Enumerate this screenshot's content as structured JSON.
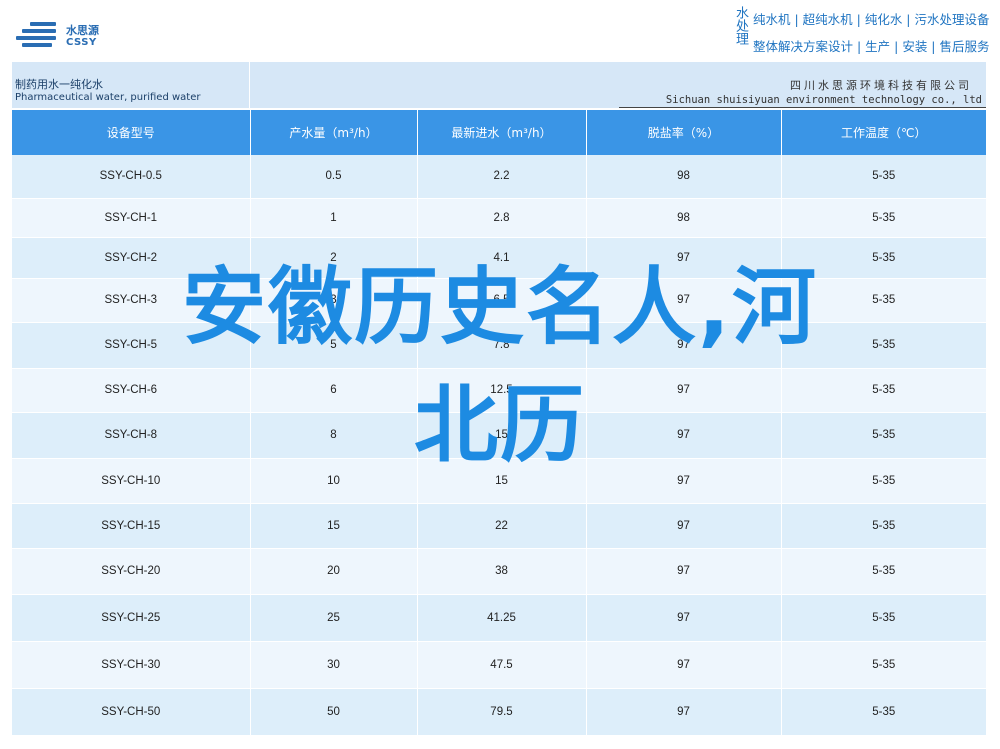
{
  "header": {
    "logo_cn": "水思源",
    "logo_en": "CSSY",
    "vertical_tag": "水处理",
    "line1": "纯水机 | 超纯水机 | 纯化水 | 污水处理设备",
    "line2": "整体解决方案设计 | 生产 | 安装 | 售后服务"
  },
  "band": {
    "left_cn": "制药用水一纯化水",
    "left_en": "Pharmaceutical water, purified water",
    "right_cn": "四川水思源环境科技有限公司",
    "right_en": "Sichuan shuisiyuan environment technology co., ltd"
  },
  "table": {
    "columns": [
      "设备型号",
      "产水量（m³/h）",
      "最新进水（m³/h）",
      "脱盐率（%）",
      "工作温度（℃）"
    ],
    "rows": [
      [
        "SSY-CH-0.5",
        "0.5",
        "2.2",
        "98",
        "5-35"
      ],
      [
        "SSY-CH-1",
        "1",
        "2.8",
        "98",
        "5-35"
      ],
      [
        "SSY-CH-2",
        "2",
        "4.1",
        "97",
        "5-35"
      ],
      [
        "SSY-CH-3",
        "3",
        "6.5",
        "97",
        "5-35"
      ],
      [
        "SSY-CH-5",
        "5",
        "7.8",
        "97",
        "5-35"
      ],
      [
        "SSY-CH-6",
        "6",
        "12.5",
        "97",
        "5-35"
      ],
      [
        "SSY-CH-8",
        "8",
        "15",
        "97",
        "5-35"
      ],
      [
        "SSY-CH-10",
        "10",
        "15",
        "97",
        "5-35"
      ],
      [
        "SSY-CH-15",
        "15",
        "22",
        "97",
        "5-35"
      ],
      [
        "SSY-CH-20",
        "20",
        "38",
        "97",
        "5-35"
      ],
      [
        "SSY-CH-25",
        "25",
        "41.25",
        "97",
        "5-35"
      ],
      [
        "SSY-CH-30",
        "30",
        "47.5",
        "97",
        "5-35"
      ],
      [
        "SSY-CH-50",
        "50",
        "79.5",
        "97",
        "5-35"
      ]
    ]
  },
  "overlay": {
    "line1": "安徽历史名人,河",
    "line2": "北历"
  },
  "colors": {
    "header_blue": "#3a95e6",
    "brand_blue": "#1f74c1",
    "overlay_blue": "#1d8be2",
    "row_light": "#ddeefa",
    "row_lighter": "#eef6fd"
  }
}
